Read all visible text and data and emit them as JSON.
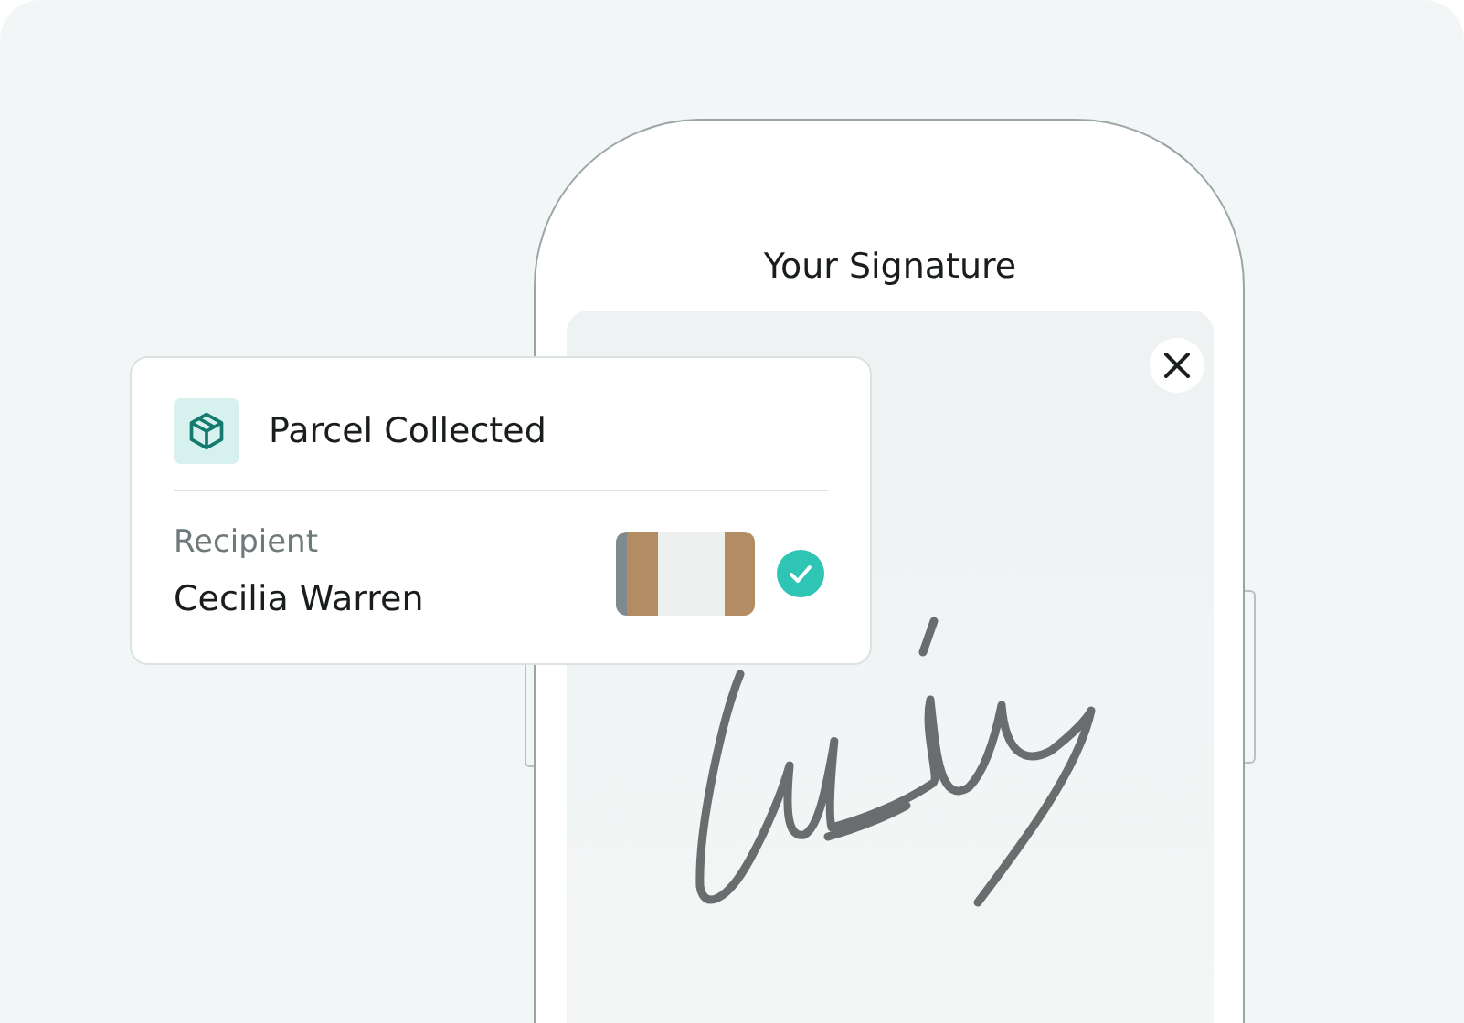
{
  "phone": {
    "title": "Your Signature"
  },
  "card": {
    "title": "Parcel Collected",
    "label": "Recipient",
    "name": "Cecilia Warren",
    "verified": true
  }
}
